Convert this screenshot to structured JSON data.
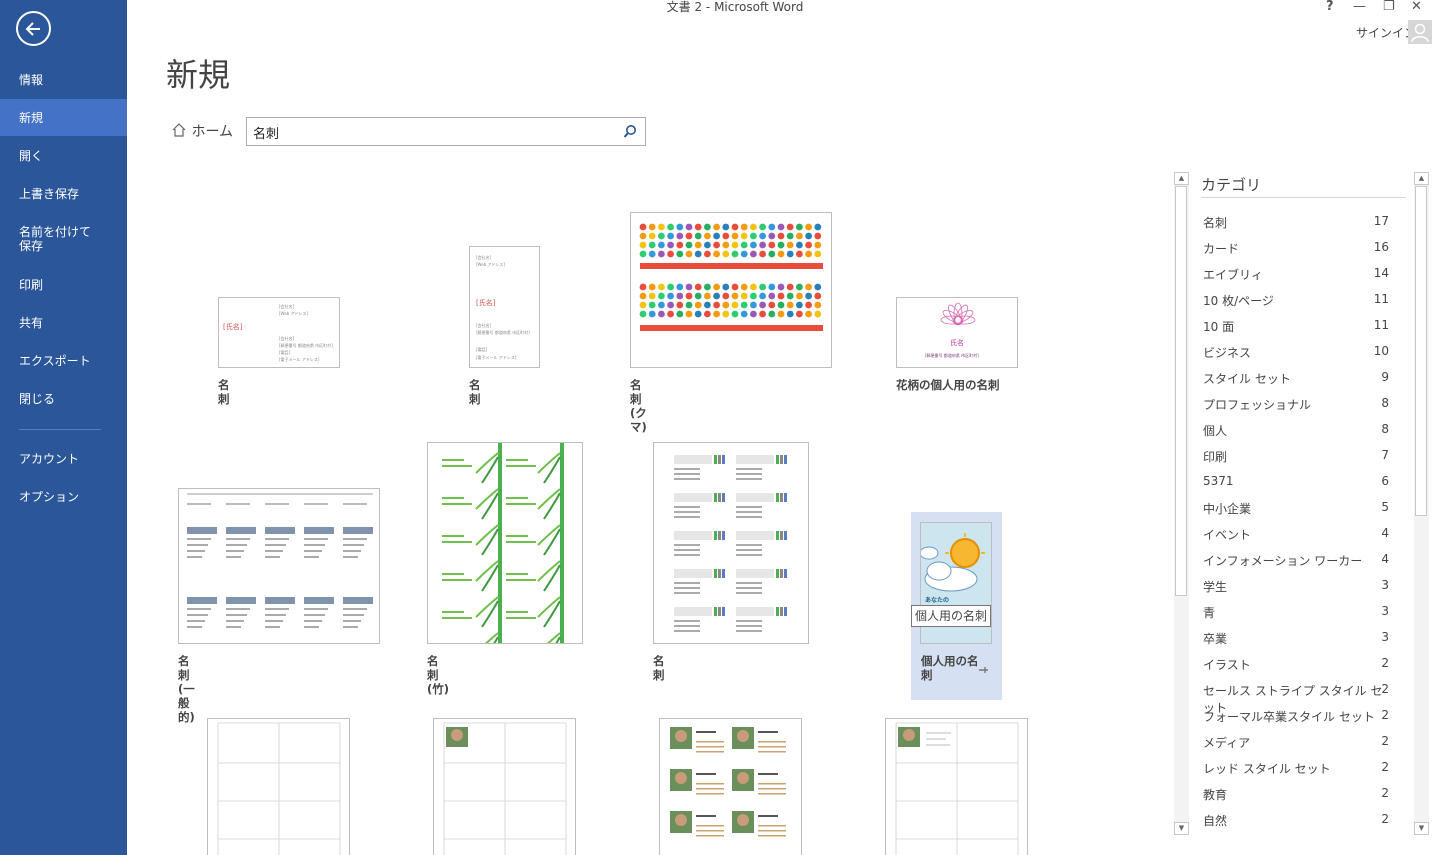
{
  "window": {
    "title": "文書 2 - Microsoft Word",
    "help": "?",
    "minimize": "—",
    "restore": "❐",
    "close": "✕",
    "signin": "サインイン"
  },
  "sidebar": {
    "items": [
      {
        "label": "情報"
      },
      {
        "label": "新規",
        "active": true
      },
      {
        "label": "開く"
      },
      {
        "label": "上書き保存"
      },
      {
        "label": "名前を付けて\n保存"
      },
      {
        "label": "印刷"
      },
      {
        "label": "共有"
      },
      {
        "label": "エクスポート"
      },
      {
        "label": "閉じる"
      },
      {
        "label": "アカウント"
      },
      {
        "label": "オプション"
      }
    ]
  },
  "main": {
    "title": "新規",
    "home_label": "ホーム",
    "search_value": "名刺",
    "templates": [
      {
        "label": "名刺"
      },
      {
        "label": "名刺"
      },
      {
        "label": "名刺 (クマ)"
      },
      {
        "label": "花柄の個人用の名刺"
      },
      {
        "label": "名刺 (一般的)"
      },
      {
        "label": "名刺 (竹)"
      },
      {
        "label": "名刺"
      },
      {
        "label": "個人用の名刺"
      }
    ],
    "tooltip": "個人用の名刺",
    "thumb_texts": {
      "name_field": "[氏名]",
      "company": "[会社名]",
      "web": "[Web アドレス]",
      "address": "[郵便番号 都道府県 市区町村]",
      "phone": "[電話]",
      "email": "[電子メール アドレス]",
      "name_small": "氏名",
      "bamboo": "あなたの\n名前をここに入力",
      "anata": "あなたの"
    }
  },
  "categories": {
    "header": "カテゴリ",
    "items": [
      {
        "name": "名刺",
        "count": "17"
      },
      {
        "name": "カード",
        "count": "16"
      },
      {
        "name": "エイブリィ",
        "count": "14"
      },
      {
        "name": "10 枚/ページ",
        "count": "11"
      },
      {
        "name": "10 面",
        "count": "11"
      },
      {
        "name": "ビジネス",
        "count": "10"
      },
      {
        "name": "スタイル セット",
        "count": "9"
      },
      {
        "name": "プロフェッショナル",
        "count": "8"
      },
      {
        "name": "個人",
        "count": "8"
      },
      {
        "name": "印刷",
        "count": "7"
      },
      {
        "name": "5371",
        "count": "6"
      },
      {
        "name": "中小企業",
        "count": "5"
      },
      {
        "name": "イベント",
        "count": "4"
      },
      {
        "name": "インフォメーション ワーカー",
        "count": "4"
      },
      {
        "name": "学生",
        "count": "3"
      },
      {
        "name": "青",
        "count": "3"
      },
      {
        "name": "卒業",
        "count": "3"
      },
      {
        "name": "イラスト",
        "count": "2"
      },
      {
        "name": "セールス ストライプ スタイル セット",
        "count": "2"
      },
      {
        "name": "フォーマル卒業スタイル セット",
        "count": "2"
      },
      {
        "name": "メディア",
        "count": "2"
      },
      {
        "name": "レッド スタイル セット",
        "count": "2"
      },
      {
        "name": "教育",
        "count": "2"
      },
      {
        "name": "自然",
        "count": "2"
      }
    ]
  }
}
